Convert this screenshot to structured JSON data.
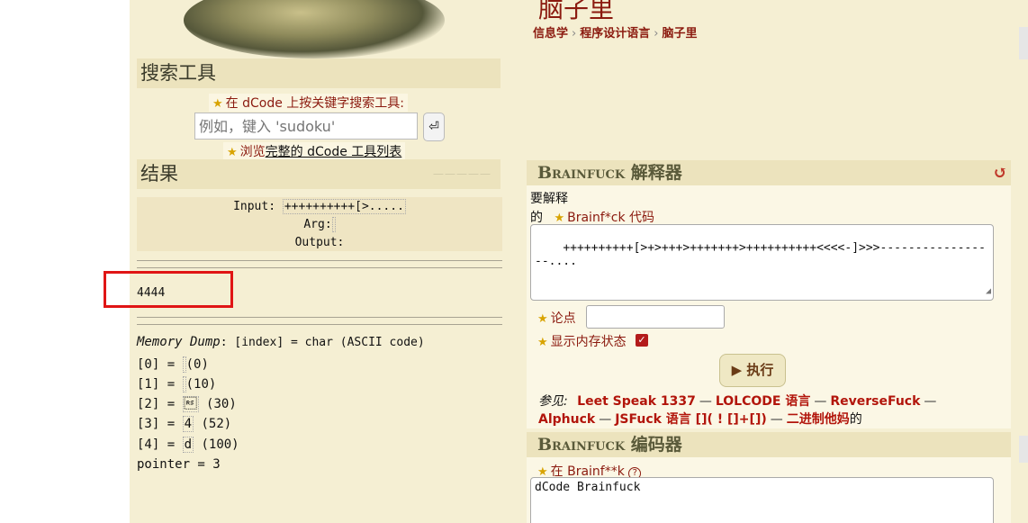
{
  "search": {
    "section_title": "搜索工具",
    "label": "在 dCode 上按关键字搜索工具:",
    "placeholder": "例如，键入 'sudoku'",
    "submit_icon": "⏎",
    "browse_prefix": "浏览",
    "browse_link": "完整的 dCode 工具列表"
  },
  "results": {
    "section_title": "结果",
    "input_label": "Input:",
    "input_value": "++++++++++[>.....",
    "arg_label": "Arg:",
    "output_label": "Output:",
    "output_value": "4444",
    "memory_title": "Memory Dump",
    "memory_legend": ": [index] = char (ASCII code)",
    "memory": [
      {
        "index": "[0] =",
        "char": " ",
        "code": "(0)"
      },
      {
        "index": "[1] =",
        "char": " ",
        "code": "(10)"
      },
      {
        "index": "[2] =",
        "char": "\u001e",
        "code": "(30)"
      },
      {
        "index": "[3] =",
        "char": "4",
        "code": "(52)"
      },
      {
        "index": "[4] =",
        "char": "d",
        "code": "(100)"
      }
    ],
    "pointer": "pointer = 3"
  },
  "page": {
    "title": "脑子里",
    "breadcrumb": [
      "信息学",
      "程序设计语言",
      "脑子里"
    ]
  },
  "interpreter": {
    "title": "Brainfuck 解释器",
    "code_label_line1": "要解释",
    "code_label_line2_prefix": "的",
    "code_label_line2": "Brainf*ck 代码",
    "code_value": "++++++++++[>+>+++>+++++++>++++++++++<<<<-]>>>-----------------....",
    "arg_label": "论点",
    "memory_toggle_label": "显示内存状态",
    "memory_toggle_checked": true,
    "run_button": "▶ 执行",
    "see_also_label": "参见:",
    "see_also_links": [
      "Leet Speak 1337",
      "LOLCODE 语言",
      "ReverseFuck",
      "Alphuck",
      "JSFuck 语言 []( ! []+[])",
      "二进制他妈"
    ],
    "see_also_suffix": "的"
  },
  "encoder": {
    "title": "Brainfuck 编码器",
    "label": "在 Brainf**k",
    "help_icon": "?",
    "text_value": "dCode Brainfuck"
  },
  "colors": {
    "background": "#f5efd3",
    "accent_red": "#8b1a0f",
    "highlight": "#e01515"
  }
}
